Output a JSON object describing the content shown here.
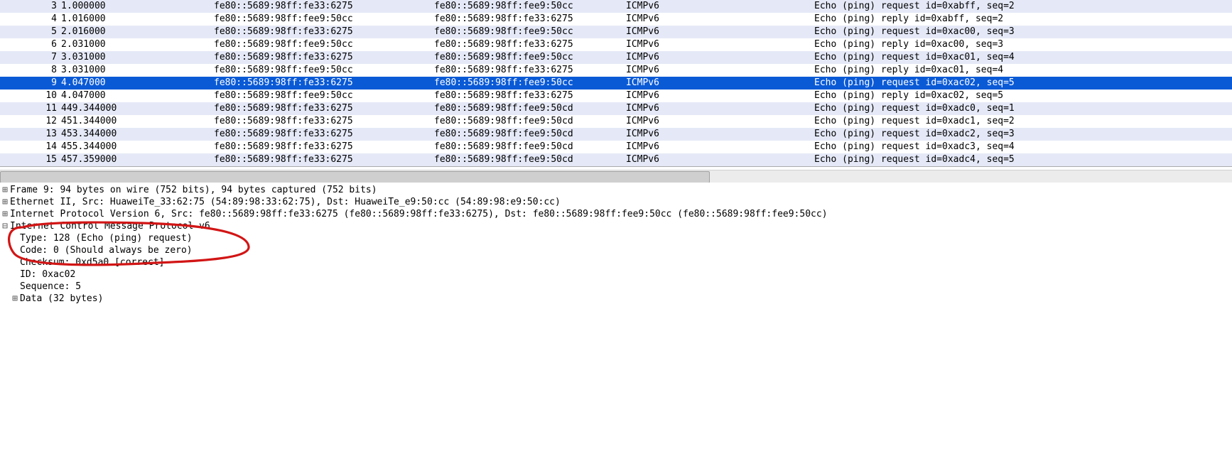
{
  "packet_list": {
    "rows": [
      {
        "no": "3",
        "time": "1.000000",
        "src": "fe80::5689:98ff:fe33:6275",
        "dst": "fe80::5689:98ff:fee9:50cc",
        "proto": "ICMPv6",
        "info": "Echo (ping) request id=0xabff, seq=2",
        "sel": false
      },
      {
        "no": "4",
        "time": "1.016000",
        "src": "fe80::5689:98ff:fee9:50cc",
        "dst": "fe80::5689:98ff:fe33:6275",
        "proto": "ICMPv6",
        "info": "Echo (ping) reply id=0xabff, seq=2",
        "sel": false
      },
      {
        "no": "5",
        "time": "2.016000",
        "src": "fe80::5689:98ff:fe33:6275",
        "dst": "fe80::5689:98ff:fee9:50cc",
        "proto": "ICMPv6",
        "info": "Echo (ping) request id=0xac00, seq=3",
        "sel": false
      },
      {
        "no": "6",
        "time": "2.031000",
        "src": "fe80::5689:98ff:fee9:50cc",
        "dst": "fe80::5689:98ff:fe33:6275",
        "proto": "ICMPv6",
        "info": "Echo (ping) reply id=0xac00, seq=3",
        "sel": false
      },
      {
        "no": "7",
        "time": "3.031000",
        "src": "fe80::5689:98ff:fe33:6275",
        "dst": "fe80::5689:98ff:fee9:50cc",
        "proto": "ICMPv6",
        "info": "Echo (ping) request id=0xac01, seq=4",
        "sel": false
      },
      {
        "no": "8",
        "time": "3.031000",
        "src": "fe80::5689:98ff:fee9:50cc",
        "dst": "fe80::5689:98ff:fe33:6275",
        "proto": "ICMPv6",
        "info": "Echo (ping) reply id=0xac01, seq=4",
        "sel": false
      },
      {
        "no": "9",
        "time": "4.047000",
        "src": "fe80::5689:98ff:fe33:6275",
        "dst": "fe80::5689:98ff:fee9:50cc",
        "proto": "ICMPv6",
        "info": "Echo (ping) request id=0xac02, seq=5",
        "sel": true
      },
      {
        "no": "10",
        "time": "4.047000",
        "src": "fe80::5689:98ff:fee9:50cc",
        "dst": "fe80::5689:98ff:fe33:6275",
        "proto": "ICMPv6",
        "info": "Echo (ping) reply id=0xac02, seq=5",
        "sel": false
      },
      {
        "no": "11",
        "time": "449.344000",
        "src": "fe80::5689:98ff:fe33:6275",
        "dst": "fe80::5689:98ff:fee9:50cd",
        "proto": "ICMPv6",
        "info": "Echo (ping) request id=0xadc0, seq=1",
        "sel": false
      },
      {
        "no": "12",
        "time": "451.344000",
        "src": "fe80::5689:98ff:fe33:6275",
        "dst": "fe80::5689:98ff:fee9:50cd",
        "proto": "ICMPv6",
        "info": "Echo (ping) request id=0xadc1, seq=2",
        "sel": false
      },
      {
        "no": "13",
        "time": "453.344000",
        "src": "fe80::5689:98ff:fe33:6275",
        "dst": "fe80::5689:98ff:fee9:50cd",
        "proto": "ICMPv6",
        "info": "Echo (ping) request id=0xadc2, seq=3",
        "sel": false
      },
      {
        "no": "14",
        "time": "455.344000",
        "src": "fe80::5689:98ff:fe33:6275",
        "dst": "fe80::5689:98ff:fee9:50cd",
        "proto": "ICMPv6",
        "info": "Echo (ping) request id=0xadc3, seq=4",
        "sel": false
      },
      {
        "no": "15",
        "time": "457.359000",
        "src": "fe80::5689:98ff:fe33:6275",
        "dst": "fe80::5689:98ff:fee9:50cd",
        "proto": "ICMPv6",
        "info": "Echo (ping) request id=0xadc4, seq=5",
        "sel": false
      }
    ]
  },
  "details": {
    "frame": "Frame 9: 94 bytes on wire (752 bits), 94 bytes captured (752 bits)",
    "eth": "Ethernet II, Src: HuaweiTe_33:62:75 (54:89:98:33:62:75), Dst: HuaweiTe_e9:50:cc (54:89:98:e9:50:cc)",
    "ipv6": "Internet Protocol Version 6, Src: fe80::5689:98ff:fe33:6275 (fe80::5689:98ff:fe33:6275), Dst: fe80::5689:98ff:fee9:50cc (fe80::5689:98ff:fee9:50cc)",
    "icmpv6": "Internet Control Message Protocol v6",
    "type": "Type: 128 (Echo (ping) request)",
    "code": "Code: 0 (Should always be zero)",
    "cksum": "Checksum: 0xd5a0 [correct]",
    "id": "ID: 0xac02",
    "seq": "Sequence: 5",
    "data": "Data (32 bytes)"
  },
  "icons": {
    "plus": "⊞",
    "minus": "⊟"
  }
}
